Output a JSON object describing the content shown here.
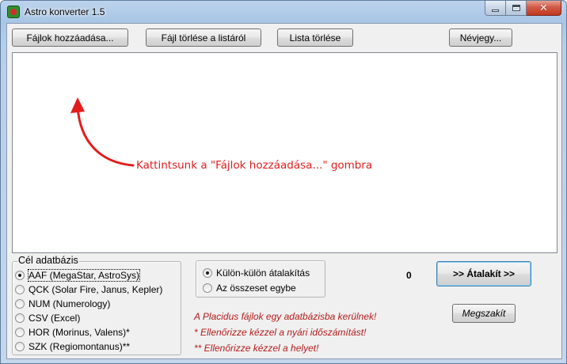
{
  "window": {
    "title": "Astro konverter 1.5",
    "minimize_glyph": "",
    "close_glyph": "✕"
  },
  "toolbar": {
    "add_files_label": "Fájlok hozzáadása...",
    "remove_file_label": "Fájl törlése a listáról",
    "clear_list_label": "Lista törlése",
    "about_label": "Névjegy..."
  },
  "file_list": {
    "annotation": "Kattintsunk a \"Fájlok hozzáadása...\" gombra",
    "annotation_color": "#e31d1d"
  },
  "target_db": {
    "title": "Cél adatbázis",
    "options": [
      {
        "label": "AAF (MegaStar, AstroSys)",
        "selected": true
      },
      {
        "label": "QCK (Solar Fire, Janus, Kepler)",
        "selected": false
      },
      {
        "label": "NUM (Numerology)",
        "selected": false
      },
      {
        "label": "CSV (Excel)",
        "selected": false
      },
      {
        "label": "HOR (Morinus, Valens)*",
        "selected": false
      },
      {
        "label": "SZK (Regiomontanus)**",
        "selected": false
      }
    ]
  },
  "mode": {
    "options": [
      {
        "label": "Külön-külön átalakítás",
        "selected": true
      },
      {
        "label": "Az összeset egybe",
        "selected": false
      }
    ]
  },
  "status": {
    "count": "0",
    "convert_label": ">> Átalakít >>",
    "cancel_label": "Megszakít"
  },
  "notes": {
    "color": "#b51c1c",
    "placidus": "A Placidus fájlok egy adatbázisba kerülnek!",
    "dst": "*  Ellenőrizze kézzel a nyári időszámítást!",
    "place": "** Ellenőrizze kézzel a helyet!"
  }
}
